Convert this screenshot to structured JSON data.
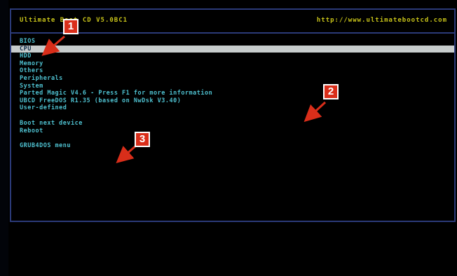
{
  "header": {
    "title": "Ultimate Boot CD V5.0BC1",
    "url": "http://www.ultimatebootcd.com"
  },
  "menu": {
    "items": [
      {
        "label": "BIOS"
      },
      {
        "label": "CPU",
        "selected": true
      },
      {
        "label": "HDD"
      },
      {
        "label": "Memory"
      },
      {
        "label": "Others"
      },
      {
        "label": "Peripherals"
      },
      {
        "label": "System"
      },
      {
        "label": "Parted Magic V4.6 - Press F1 for more information"
      },
      {
        "label": "UBCD FreeDOS R1.35 (based on NwDsk V3.40)"
      },
      {
        "label": "User-defined"
      },
      {
        "label": "Boot next device"
      },
      {
        "label": "Reboot"
      },
      {
        "label": "GRUB4DOS menu"
      }
    ]
  },
  "annotations": [
    {
      "number": "1"
    },
    {
      "number": "2"
    },
    {
      "number": "3"
    }
  ],
  "colors": {
    "header_text": "#c8c31a",
    "menu_text": "#4ec0cf",
    "selection_bar": "#c7cccc",
    "frame_border": "#2b3a78",
    "badge": "#d92e1a"
  }
}
